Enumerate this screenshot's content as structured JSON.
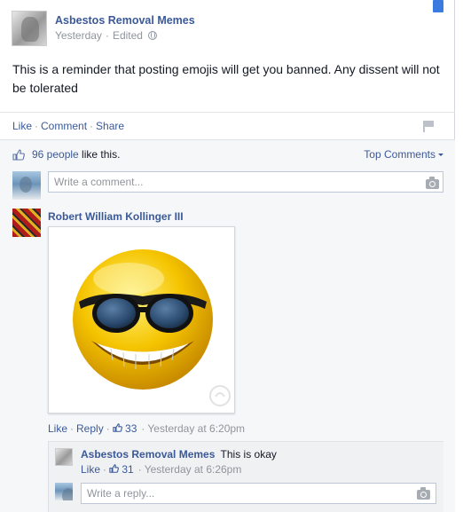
{
  "post": {
    "page_name": "Asbestos Removal Memes",
    "time": "Yesterday",
    "edited": "Edited",
    "text": "This is a reminder that posting emojis will get you banned. Any dissent will not be tolerated"
  },
  "actions": {
    "like": "Like",
    "comment": "Comment",
    "share": "Share",
    "separator": "·"
  },
  "likes": {
    "count_text": "96 people",
    "suffix": " like this.",
    "sort_label": "Top Comments"
  },
  "composer": {
    "placeholder": "Write a comment..."
  },
  "comment": {
    "author": "Robert William Kollinger III",
    "like": "Like",
    "reply": "Reply",
    "like_count": "33",
    "time": "Yesterday at 6:20pm"
  },
  "reply": {
    "author": "Asbestos Removal Memes",
    "text": "This is okay",
    "like": "Like",
    "like_count": "31",
    "time": "Yesterday at 6:26pm",
    "placeholder": "Write a reply..."
  },
  "icons": {
    "globe": "globe-icon",
    "flag": "flag-icon",
    "thumb": "thumbs-up-icon",
    "camera": "camera-icon",
    "emoji": "sunglasses-emoji"
  },
  "colors": {
    "link": "#3b5998",
    "meta": "#90949c",
    "emoji_yellow": "#f5c400"
  }
}
